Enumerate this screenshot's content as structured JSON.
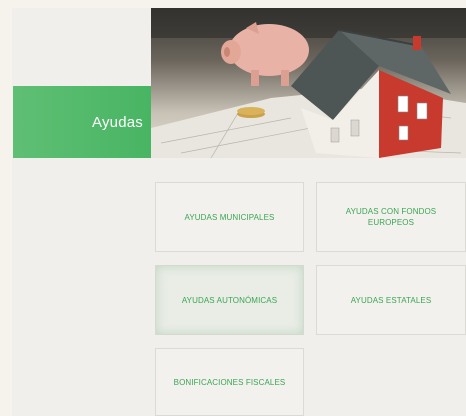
{
  "banner": {
    "label": "Ayudas"
  },
  "tiles": [
    {
      "label": "AYUDAS MUNICIPALES"
    },
    {
      "label": "AYUDAS CON FONDOS EUROPEOS"
    },
    {
      "label": "AYUDAS AUTONÓMICAS"
    },
    {
      "label": "AYUDAS ESTATALES"
    },
    {
      "label": "BONIFICACIONES FISCALES"
    }
  ],
  "colors": {
    "accent": "#4cb868",
    "tile_text": "#3aa552",
    "background": "#f1efeb"
  }
}
